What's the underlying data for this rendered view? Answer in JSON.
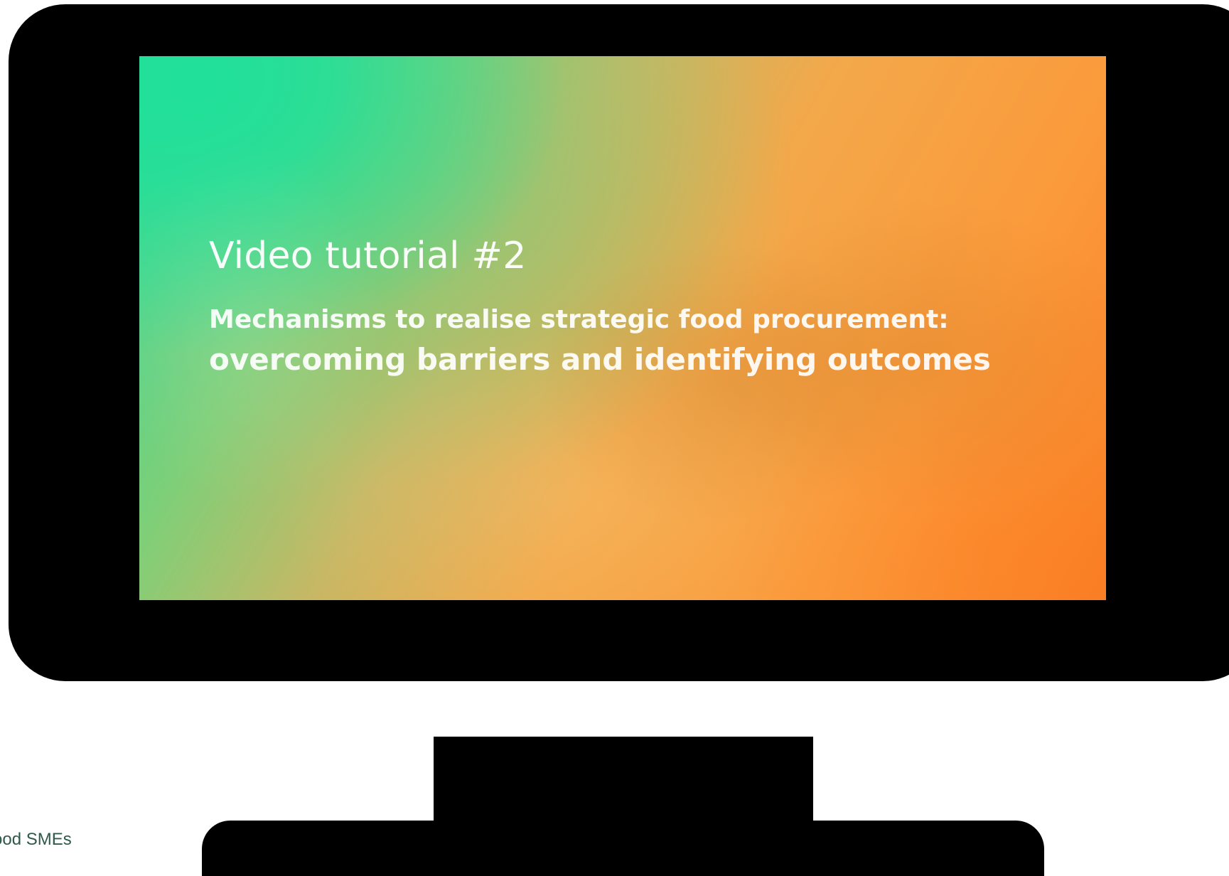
{
  "screen": {
    "title": "Video tutorial #2",
    "subtitle_line1": "Mechanisms to realise strategic food procurement:",
    "subtitle_line2": "overcoming barriers and identifying outcomes"
  },
  "footer": {
    "caption": "ood SMEs"
  },
  "colors": {
    "bezel": "#000000",
    "screen_start": "#2fd99a",
    "screen_end": "#fa7f25",
    "caption_text": "#2f5a4a"
  },
  "icons": {
    "monitor": "monitor-icon"
  }
}
